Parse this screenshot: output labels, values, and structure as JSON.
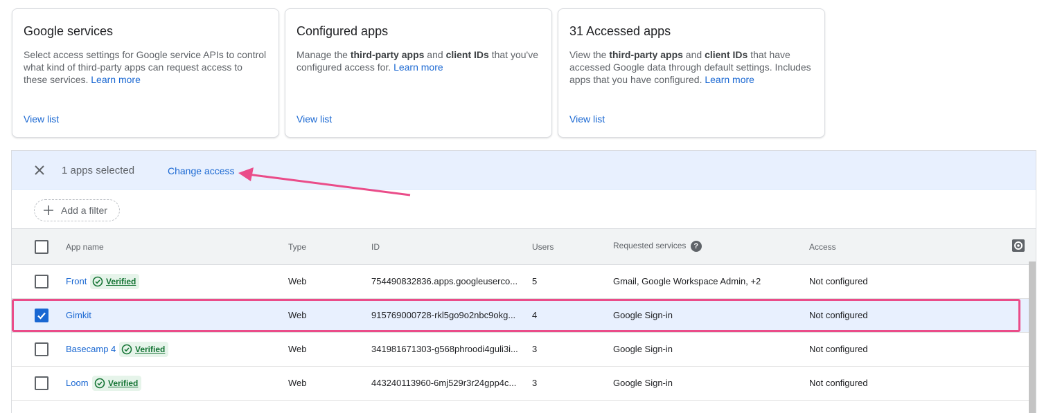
{
  "cards": [
    {
      "title": "Google services",
      "desc_html": "Select access settings for Google service APIs to control what kind of third-party apps can request access to these services. <span class=\"link\">Learn more</span>",
      "view_list": "View list"
    },
    {
      "title": "Configured apps",
      "desc_html": "Manage the <b>third-party apps</b> and <b>client IDs</b> that you've configured access for. <span class=\"link\">Learn more</span>",
      "view_list": "View list"
    },
    {
      "title": "31 Accessed apps",
      "desc_html": "View the <b>third-party apps</b> and <b>client IDs</b> that have accessed Google data through default settings. Includes apps that you have configured. <span class=\"link\">Learn more</span>",
      "view_list": "View list"
    }
  ],
  "selection_bar": {
    "count_text": "1 apps selected",
    "change_access": "Change access"
  },
  "filter": {
    "add_filter": "Add a filter"
  },
  "table": {
    "headers": {
      "app_name": "App name",
      "type": "Type",
      "id": "ID",
      "users": "Users",
      "requested_services": "Requested services",
      "access": "Access"
    },
    "verified_label": "Verified",
    "rows": [
      {
        "name": "Front",
        "verified": true,
        "selected": false,
        "type": "Web",
        "id": "754490832836.apps.googleuserco...",
        "users": "5",
        "services": "Gmail, Google Workspace Admin, +2",
        "access": "Not configured"
      },
      {
        "name": "Gimkit",
        "verified": false,
        "selected": true,
        "type": "Web",
        "id": "915769000728-rkl5go9o2nbc9okg...",
        "users": "4",
        "services": "Google Sign-in",
        "access": "Not configured"
      },
      {
        "name": "Basecamp 4",
        "verified": true,
        "selected": false,
        "type": "Web",
        "id": "341981671303-g568phroodi4guli3i...",
        "users": "3",
        "services": "Google Sign-in",
        "access": "Not configured"
      },
      {
        "name": "Loom",
        "verified": true,
        "selected": false,
        "type": "Web",
        "id": "443240113960-6mj529r3r24gpp4c...",
        "users": "3",
        "services": "Google Sign-in",
        "access": "Not configured"
      }
    ]
  },
  "colors": {
    "accent": "#1967d2",
    "annotation": "#ea4c89",
    "selected_bg": "#e8f0fe",
    "verified_bg": "#e6f4ea"
  }
}
